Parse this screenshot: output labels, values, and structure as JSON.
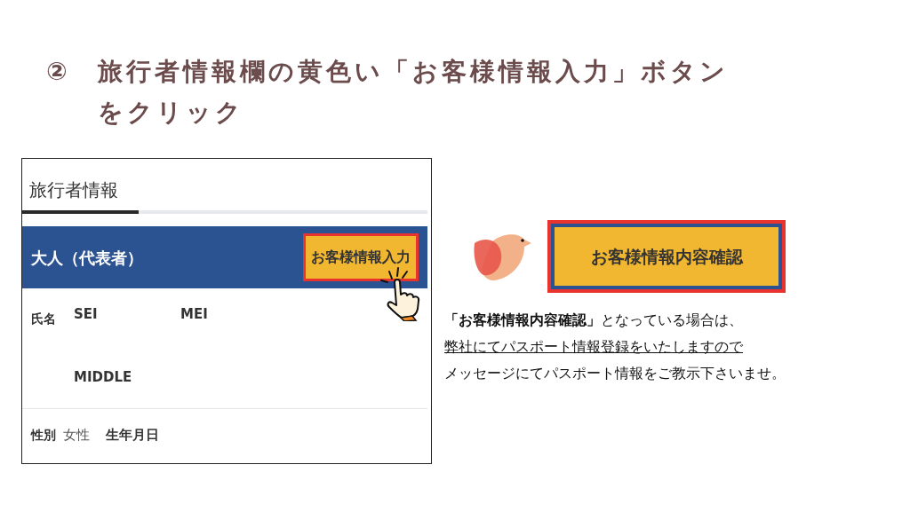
{
  "heading": {
    "number": "②",
    "lines": [
      "旅行者情報欄の黄色い「お客様情報入力」ボタン",
      "をクリック"
    ]
  },
  "panel": {
    "tab": "旅行者情報",
    "header": {
      "title": "大人（代表者）",
      "button": "お客様情報入力"
    },
    "name_label": "氏名",
    "fields": [
      "SEI",
      "MEI",
      "MIDDLE"
    ],
    "gender_label": "性別",
    "gender": "女性",
    "birth_label": "生年月日"
  },
  "note": {
    "button": "お客様情報内容確認",
    "lines": [
      {
        "text": "**「お客様情報内容確認」**となっている場合は、",
        "underline": false
      },
      {
        "text": "弊社にてパスポート情報登録をいたしますので",
        "underline": true
      },
      {
        "text": "メッセージにてパスポート情報をご教示下さいませ。",
        "underline": false
      }
    ]
  }
}
